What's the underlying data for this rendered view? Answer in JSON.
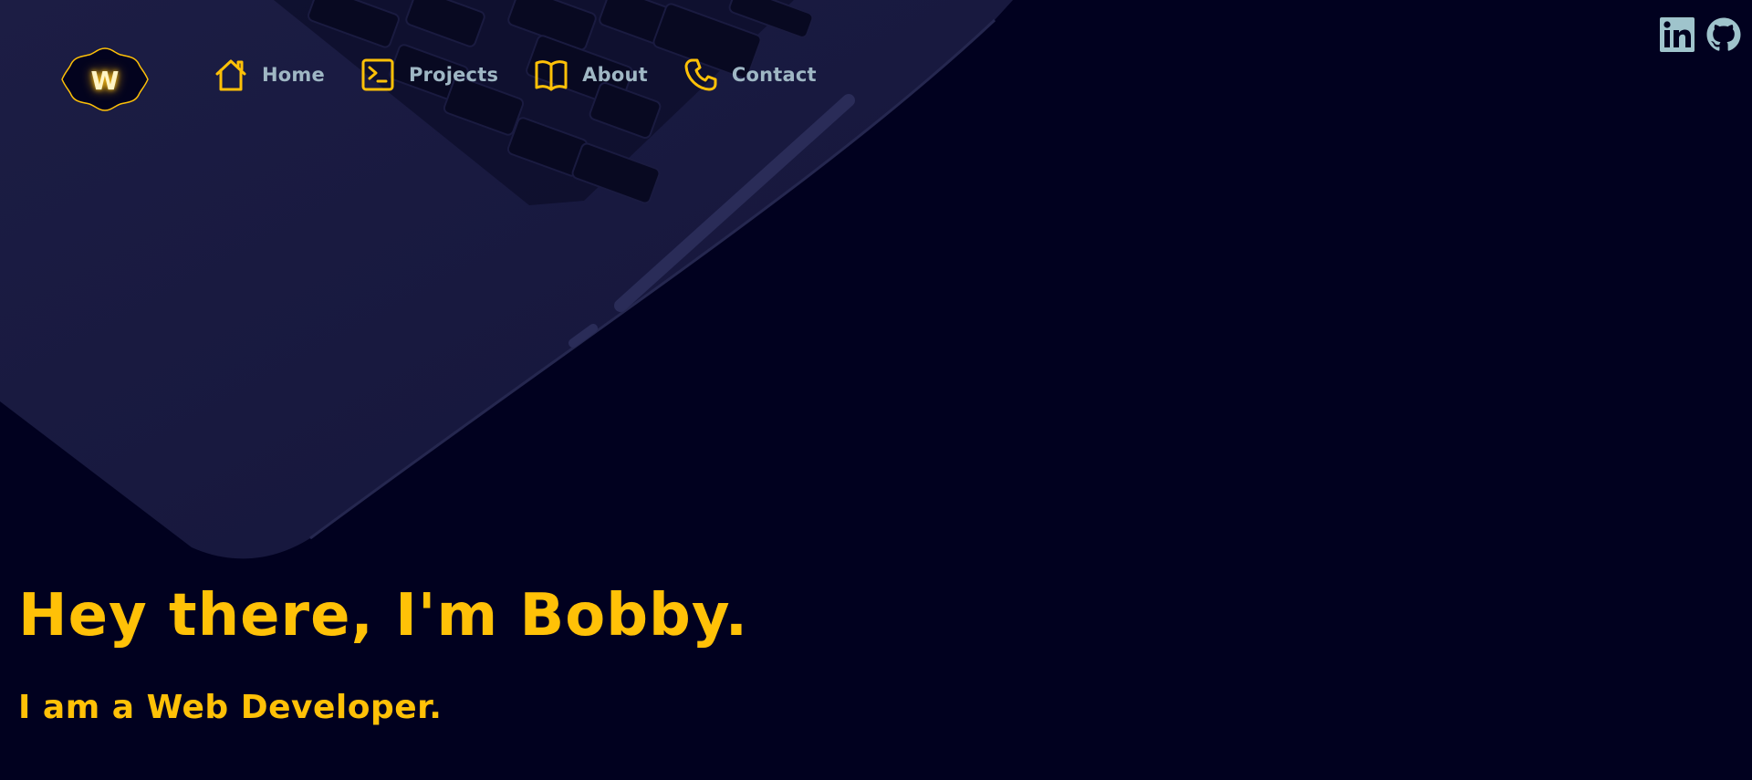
{
  "logo": {
    "letter": "W",
    "colors": {
      "glow": "#ffc107",
      "letter": "#fff4c4"
    }
  },
  "nav": {
    "items": [
      {
        "label": "Home",
        "icon": "home-icon"
      },
      {
        "label": "Projects",
        "icon": "terminal-icon"
      },
      {
        "label": "About",
        "icon": "book-icon"
      },
      {
        "label": "Contact",
        "icon": "phone-icon"
      }
    ]
  },
  "social": {
    "items": [
      {
        "icon": "linkedin-icon"
      },
      {
        "icon": "github-icon"
      }
    ]
  },
  "hero": {
    "title": "Hey there, I'm Bobby.",
    "subtitle": "I am a Web Developer."
  },
  "colors": {
    "background": "#01011f",
    "accent": "#ffc107",
    "nav_text": "#9fb7c4",
    "social_icon": "#9fc4cc"
  }
}
